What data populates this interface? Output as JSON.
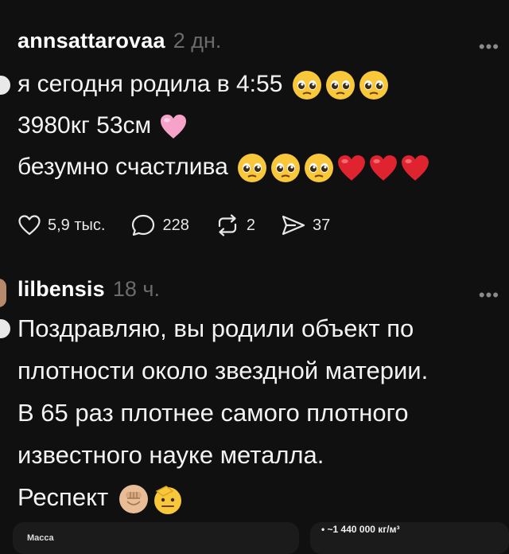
{
  "posts": [
    {
      "username": "annsattarovaa",
      "time": "2 дн.",
      "more": "•••",
      "lines": [
        "я сегодня родила в 4:55",
        "3980кг 53см",
        "безумно счастлива"
      ],
      "emojis": {
        "line1": [
          "pleading-face",
          "pleading-face",
          "pleading-face"
        ],
        "line2": [
          "pink-heart"
        ],
        "line3": [
          "pleading-face",
          "pleading-face",
          "pleading-face",
          "red-heart",
          "red-heart",
          "red-heart"
        ]
      },
      "actions": {
        "likes": "5,9 тыс.",
        "comments": "228",
        "reposts": "2",
        "shares": "37"
      }
    },
    {
      "username": "lilbensis",
      "time": "18 ч.",
      "more": "•••",
      "lines": [
        "Поздравляю, вы родили объект по",
        "плотности около звездной материи.",
        "В 65 раз плотнее самого плотного",
        "известного науке металла.",
        "Респект"
      ],
      "emojis": {
        "line5": [
          "raised-fist-light-skin",
          "saluting-face"
        ]
      }
    }
  ],
  "bottom_cards": {
    "left_label": "Macca",
    "right_value": "• ~1 440 000 кг/м³"
  },
  "colors": {
    "background": "#101010",
    "text": "#f3f3f3",
    "muted": "#6b6b6b",
    "emoji_yellow": "#f9c83a",
    "heart_red": "#e0242f",
    "heart_pink": "#f7a3c9"
  }
}
